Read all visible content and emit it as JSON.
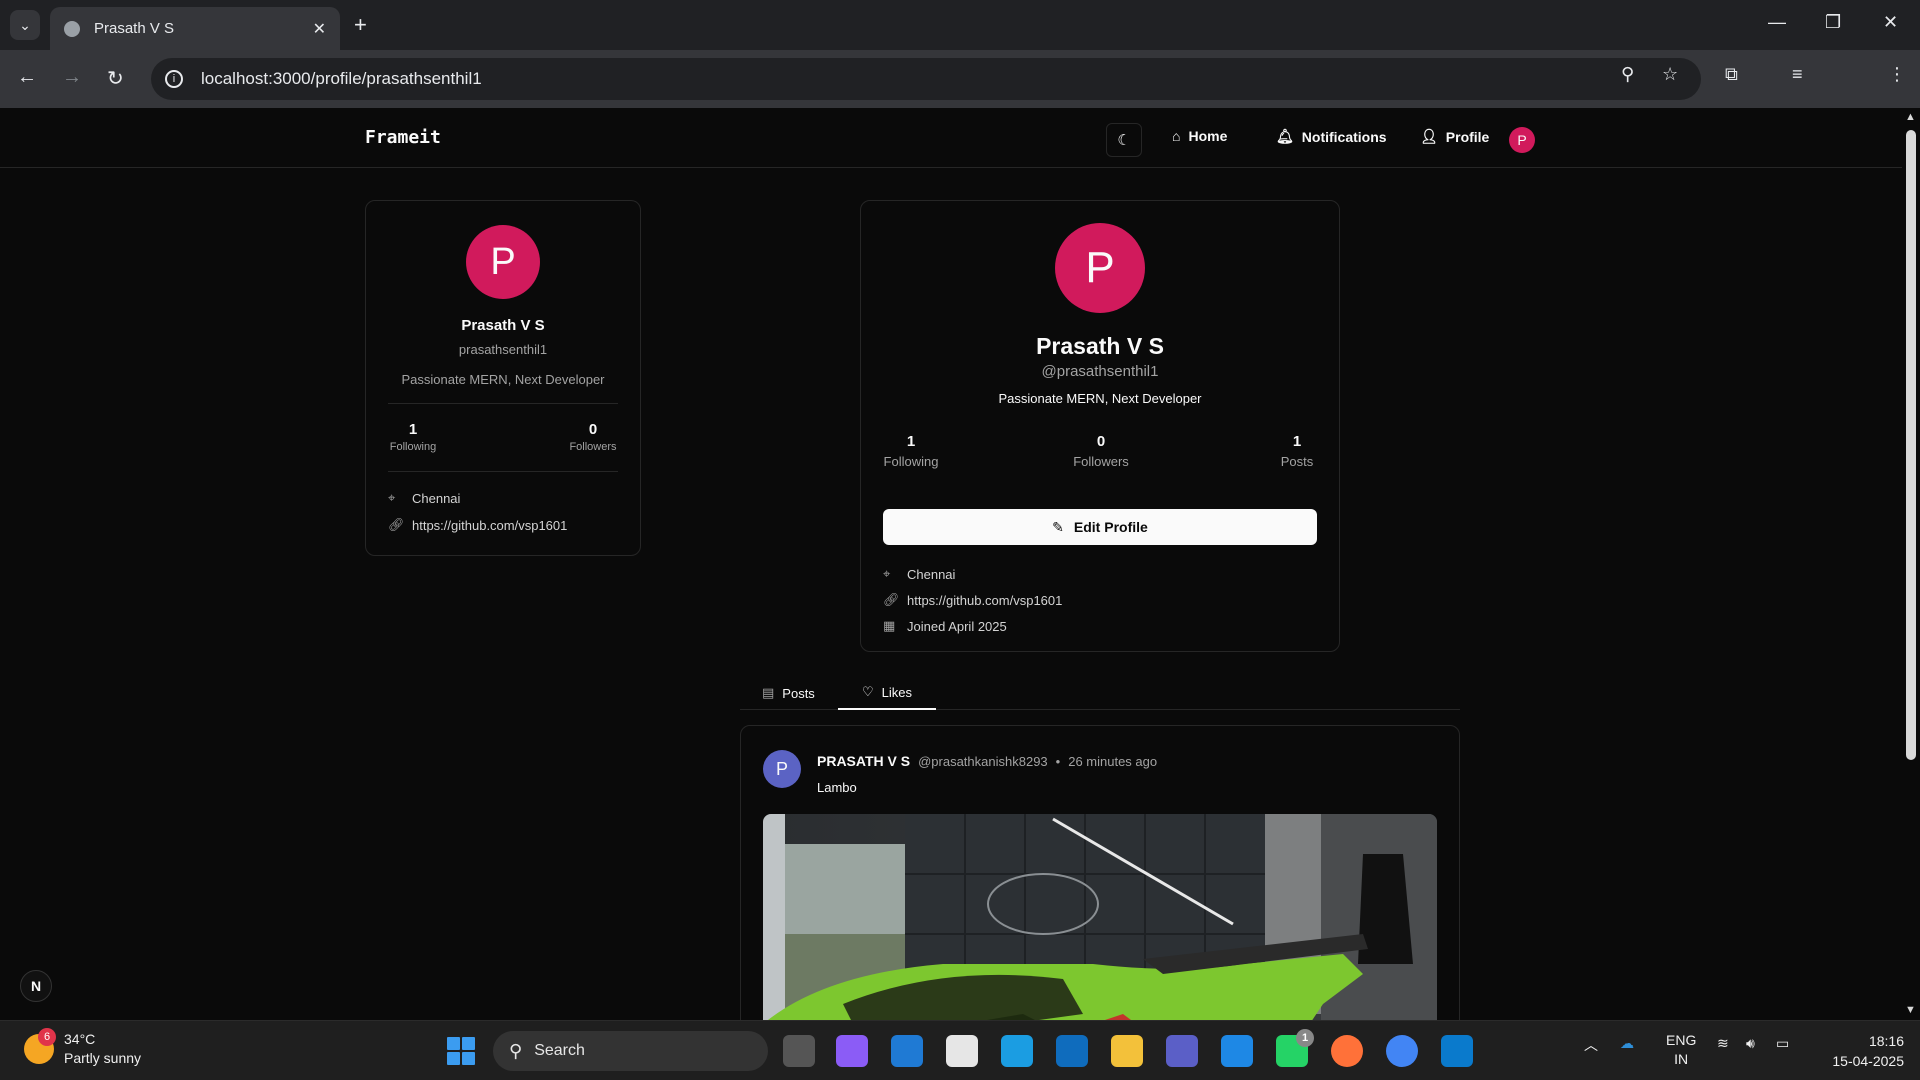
{
  "browser": {
    "tab_title": "Prasath V S",
    "url": "localhost:3000/profile/prasathsenthil1"
  },
  "header": {
    "brand": "Frameit",
    "nav": {
      "home": "Home",
      "notifications": "Notifications",
      "profile": "Profile"
    },
    "avatar_initial": "P"
  },
  "sidebar_card": {
    "avatar_initial": "P",
    "name": "Prasath V S",
    "username": "prasathsenthil1",
    "bio": "Passionate MERN, Next Developer",
    "following_count": "1",
    "following_label": "Following",
    "followers_count": "0",
    "followers_label": "Followers",
    "location": "Chennai",
    "website": "https://github.com/vsp1601"
  },
  "profile_card": {
    "avatar_initial": "P",
    "name": "Prasath V S",
    "handle": "@prasathsenthil1",
    "bio": "Passionate MERN, Next Developer",
    "stats": [
      {
        "value": "1",
        "label": "Following"
      },
      {
        "value": "0",
        "label": "Followers"
      },
      {
        "value": "1",
        "label": "Posts"
      }
    ],
    "edit_label": "Edit Profile",
    "location": "Chennai",
    "website": "https://github.com/vsp1601",
    "joined": "Joined April 2025"
  },
  "tabs": {
    "posts": "Posts",
    "likes": "Likes"
  },
  "post": {
    "avatar_initial": "P",
    "author": "PRASATH V S",
    "handle": "@prasathkanishk8293",
    "separator": "•",
    "time": "26 minutes ago",
    "content": "Lambo"
  },
  "nextjs_badge": "N",
  "taskbar": {
    "temperature": "34°C",
    "weather": "Partly sunny",
    "weather_badge": "6",
    "search_placeholder": "Search",
    "whatsapp_badge": "1",
    "lang_top": "ENG",
    "lang_bottom": "IN",
    "time": "18:16",
    "date": "15-04-2025"
  },
  "colors": {
    "avatar_pink": "#d11a5c",
    "post_avatar": "#5b63c4",
    "background": "#0a0a0a",
    "border": "#262626"
  }
}
